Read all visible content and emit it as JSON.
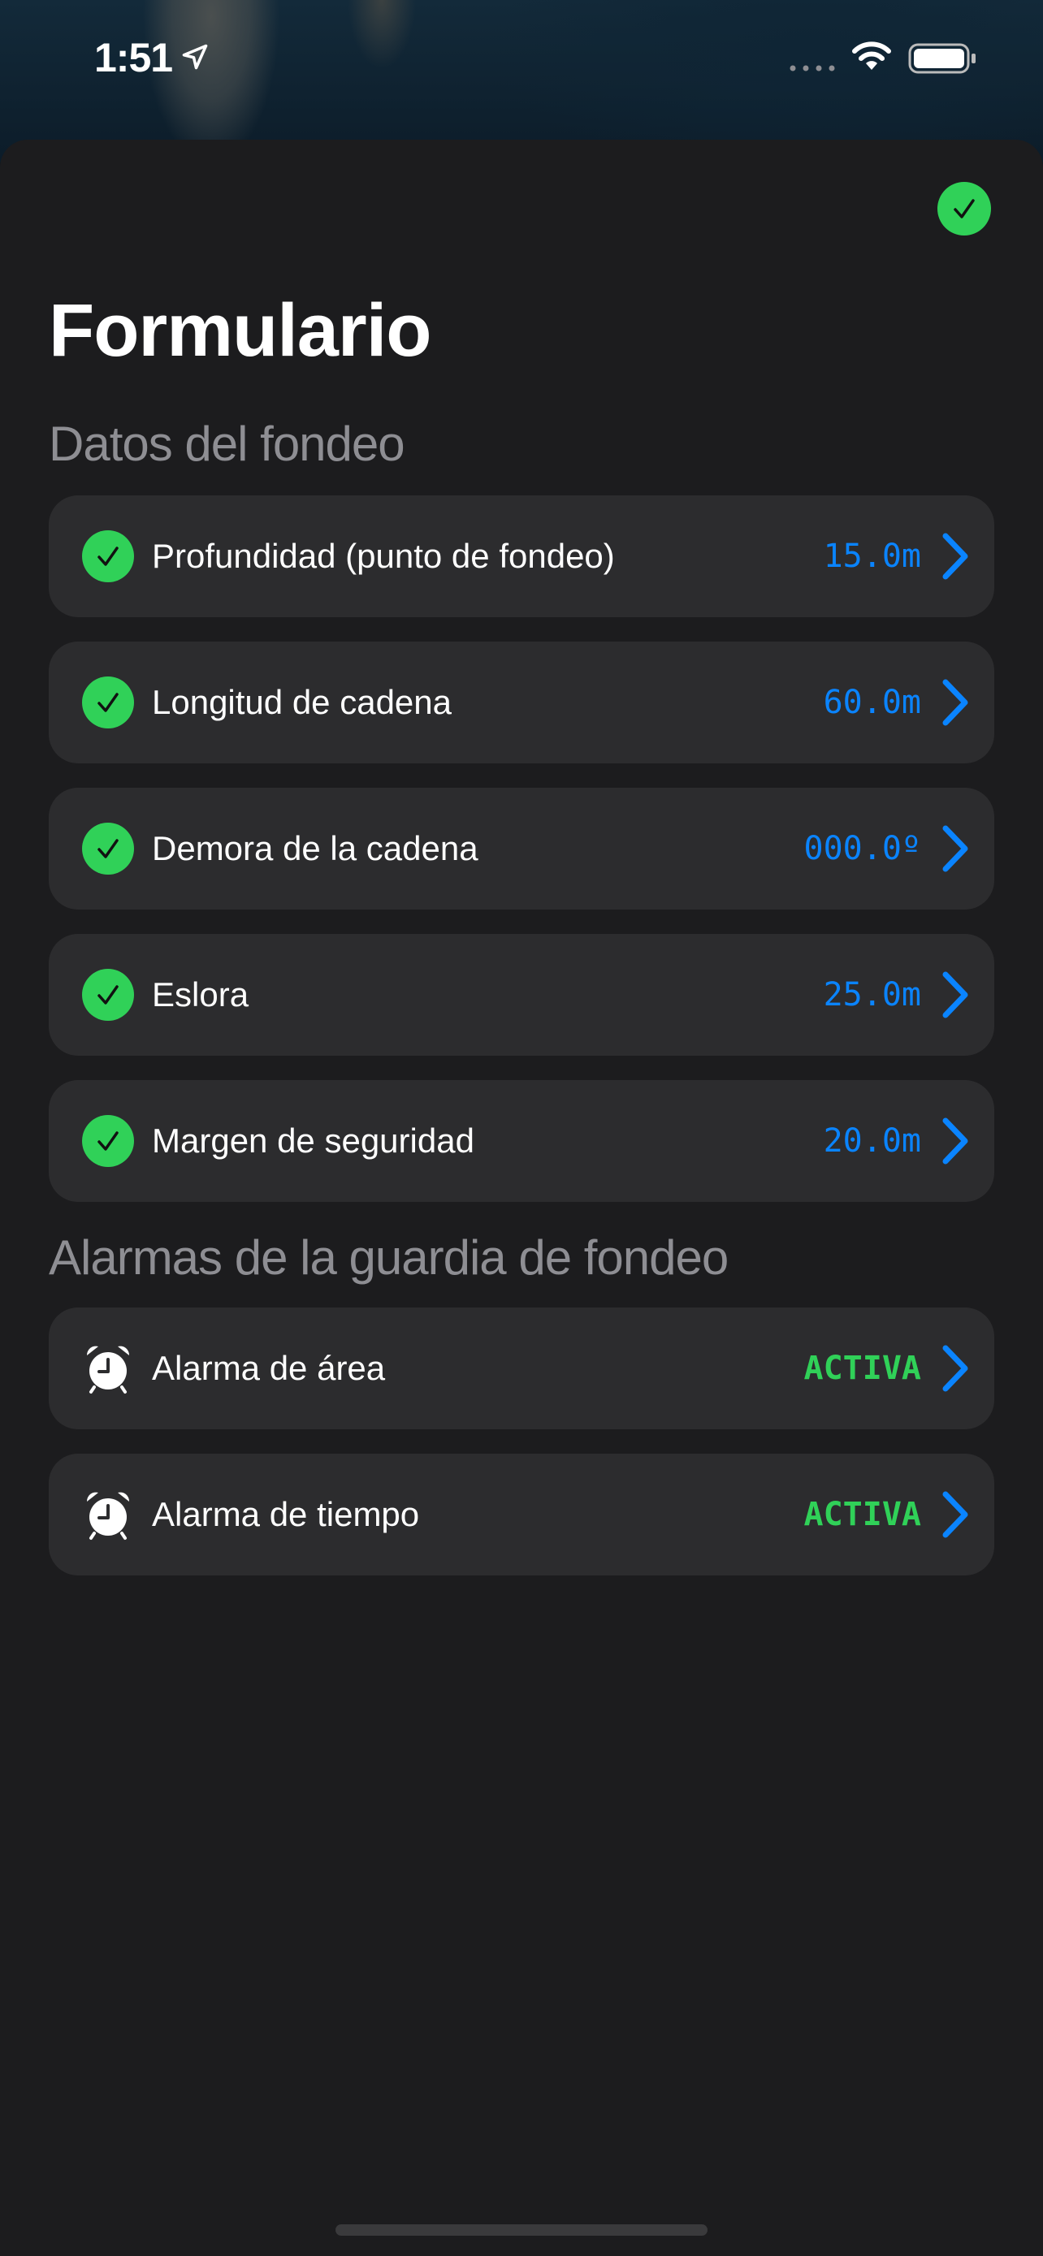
{
  "status_bar": {
    "time": "1:51"
  },
  "colors": {
    "accent_blue": "#0a84ff",
    "success_green": "#30d158",
    "sheet_bg": "#1c1c1e",
    "row_bg": "#2c2c2e",
    "section_header": "#8e8e93"
  },
  "header": {
    "title": "Formulario"
  },
  "sections": [
    {
      "header": "Datos del fondeo",
      "rows": [
        {
          "icon": "checkmark-circle-icon",
          "label": "Profundidad (punto de fondeo)",
          "value": "15.0m"
        },
        {
          "icon": "checkmark-circle-icon",
          "label": "Longitud de cadena",
          "value": "60.0m"
        },
        {
          "icon": "checkmark-circle-icon",
          "label": "Demora de la cadena",
          "value": "000.0º"
        },
        {
          "icon": "checkmark-circle-icon",
          "label": "Eslora",
          "value": "25.0m"
        },
        {
          "icon": "checkmark-circle-icon",
          "label": "Margen de seguridad",
          "value": "20.0m"
        }
      ]
    },
    {
      "header": "Alarmas de la guardia de fondeo",
      "rows": [
        {
          "icon": "alarm-clock-icon",
          "label": "Alarma de área",
          "value": "ACTIVA"
        },
        {
          "icon": "alarm-clock-icon",
          "label": "Alarma de tiempo",
          "value": "ACTIVA"
        }
      ]
    }
  ]
}
